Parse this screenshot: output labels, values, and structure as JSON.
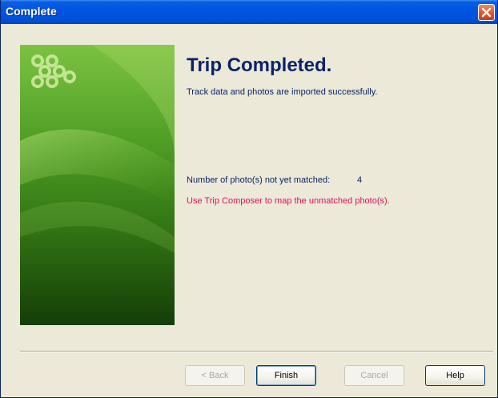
{
  "window": {
    "title": "Complete"
  },
  "main": {
    "heading": "Trip Completed.",
    "subtext": "Track data and photos are imported successfully.",
    "unmatched_label": "Number of photo(s) not yet matched:",
    "unmatched_count": "4",
    "hint": "Use Trip Composer to map the unmatched photo(s)."
  },
  "buttons": {
    "back": "< Back",
    "finish": "Finish",
    "cancel": "Cancel",
    "help": "Help"
  },
  "colors": {
    "title_bar": "#0054E3",
    "heading": "#0A246A",
    "hint": "#E0105A",
    "banner": "#3E8A18"
  }
}
